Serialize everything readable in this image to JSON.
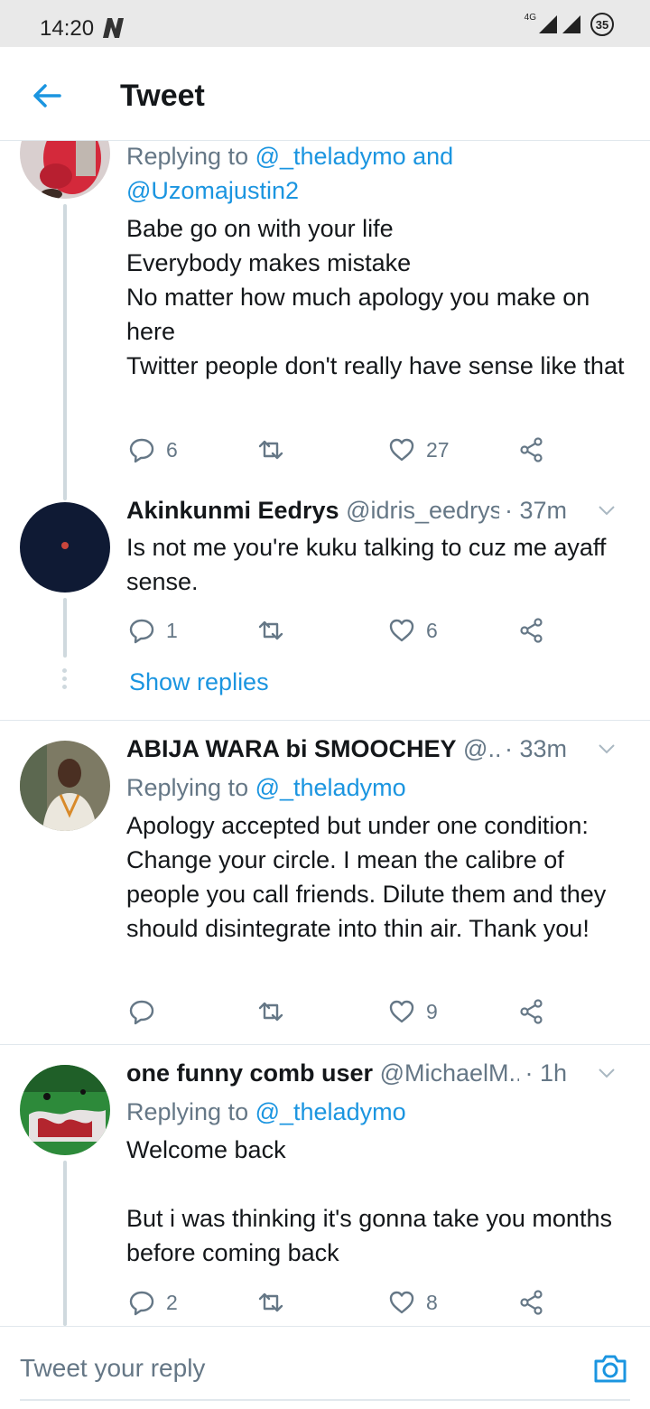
{
  "status_bar": {
    "time": "14:20",
    "network": "4G",
    "battery": "35"
  },
  "header": {
    "title": "Tweet"
  },
  "tweets": [
    {
      "replying_prefix": "Replying to ",
      "replying_to_1": "@_theladymo",
      "replying_join": " and",
      "replying_to_2": "@Uzomajustin2",
      "text": "Babe go on with your life\nEverybody makes mistake\nNo matter how much apology you make on here\nTwitter people don't really have sense like that",
      "replies": "6",
      "likes": "27"
    },
    {
      "name": "Akinkunmi Eedrys",
      "handle": "@idris_eedrys",
      "time": "· 37m",
      "text": "Is not me you're kuku talking to cuz me ayaff sense.",
      "replies": "1",
      "likes": "6",
      "show_replies": "Show replies"
    },
    {
      "name": "ABIJA WARA bi SMOOCHEY",
      "handle": "@...",
      "time": "· 33m",
      "replying_prefix": "Replying to ",
      "replying_to_1": "@_theladymo",
      "text": "Apology accepted but under one condition: Change your circle. I mean the calibre of people you call friends. Dilute them and they should disintegrate into thin air. Thank you!",
      "likes": "9"
    },
    {
      "name": "one funny comb user",
      "handle": "@MichaelM...",
      "time": "· 1h",
      "replying_prefix": "Replying to ",
      "replying_to_1": "@_theladymo",
      "text": "Welcome back\n\nBut i was thinking it's gonna take you months before coming back",
      "replies": "2",
      "likes": "8"
    }
  ],
  "composer": {
    "placeholder": "Tweet your reply"
  },
  "colors": {
    "accent": "#1b95e0",
    "muted": "#657786",
    "text": "#14171a",
    "divider": "#e1e8ed"
  }
}
